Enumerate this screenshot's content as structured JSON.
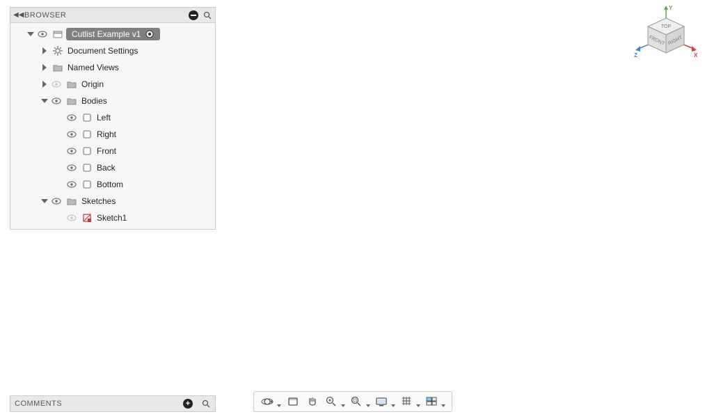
{
  "browser": {
    "title": "BROWSER",
    "root": {
      "label": "Cutlist Example v1",
      "active": true
    },
    "nodes": {
      "docSettings": "Document Settings",
      "namedViews": "Named Views",
      "origin": "Origin",
      "bodies": "Bodies",
      "bodyItems": [
        "Left",
        "Right",
        "Front",
        "Back",
        "Bottom"
      ],
      "sketches": "Sketches",
      "sketchItems": [
        "Sketch1"
      ]
    }
  },
  "comments": {
    "title": "COMMENTS"
  },
  "viewcube": {
    "faces": {
      "top": "TOP",
      "front": "FRONT",
      "right": "RIGHT"
    },
    "axes": {
      "x": "X",
      "y": "Y",
      "z": "Z"
    }
  },
  "navToolbar": {
    "tools": [
      {
        "name": "orbit",
        "dropdown": true
      },
      {
        "name": "look-at",
        "dropdown": false
      },
      {
        "name": "pan",
        "dropdown": false
      },
      {
        "name": "zoom",
        "dropdown": true
      },
      {
        "name": "fit",
        "dropdown": true
      },
      {
        "name": "display-settings",
        "dropdown": true
      },
      {
        "name": "grid-settings",
        "dropdown": true
      },
      {
        "name": "viewport-layout",
        "dropdown": true
      }
    ]
  }
}
